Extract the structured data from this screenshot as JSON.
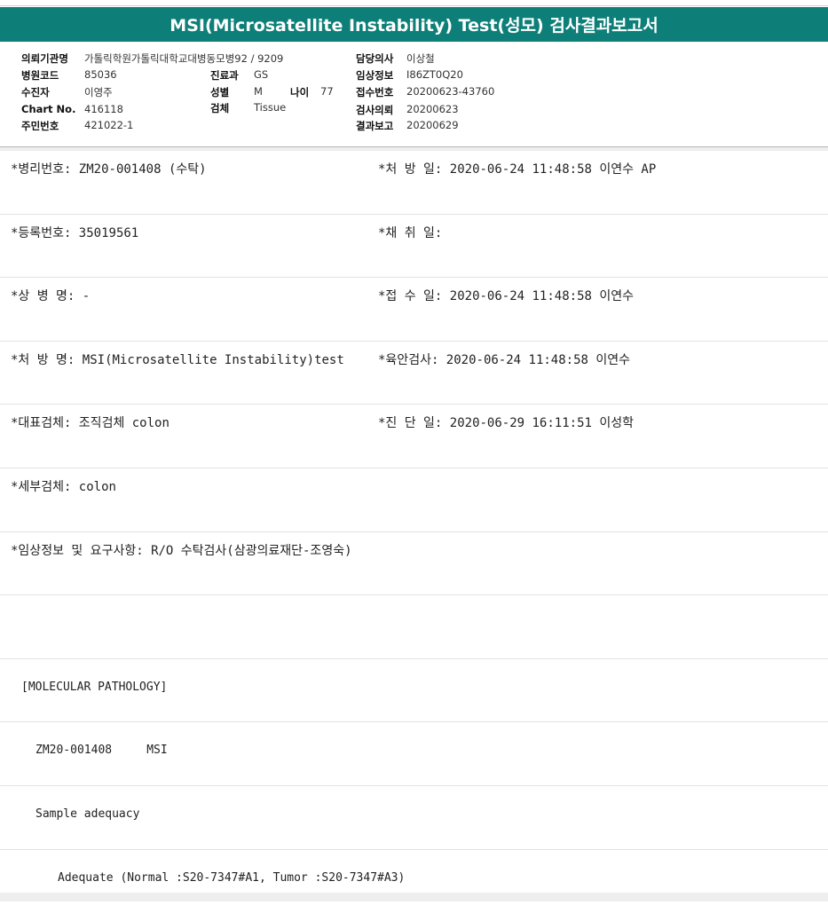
{
  "title": "MSI(Microsatellite Instability) Test(성모) 검사결과보고서",
  "info": {
    "institution": {
      "label": "의뢰기관명",
      "value": "가톨릭학원가톨릭대학교대병동모병92 / 9209"
    },
    "hospital_code": {
      "label": "병원코드",
      "value": "85036"
    },
    "patient": {
      "label": "수진자",
      "value": "이영주"
    },
    "chart_no": {
      "label": "Chart No.",
      "value": "416118"
    },
    "resident_no": {
      "label": "주민번호",
      "value": "421022-1"
    },
    "department": {
      "label": "진료과",
      "value": "GS"
    },
    "sex": {
      "label": "성별",
      "value": "M"
    },
    "age": {
      "label": "나이",
      "value": "77"
    },
    "specimen": {
      "label": "검체",
      "value": "Tissue"
    },
    "doctor": {
      "label": "담당의사",
      "value": "이상철"
    },
    "clinical_info": {
      "label": "임상정보",
      "value": "I86ZT0Q20"
    },
    "receipt_no": {
      "label": "접수번호",
      "value": "20200623-43760"
    },
    "test_request": {
      "label": "검사의뢰",
      "value": "20200623"
    },
    "result_report": {
      "label": "결과보고",
      "value": "20200629"
    }
  },
  "rows": [
    {
      "left": "*병리번호: ZM20-001408 (수탁)",
      "right": "*처 방 일: 2020-06-24 11:48:58  이연수 AP"
    },
    {
      "left": "*등록번호: 35019561",
      "right": "*채 취 일:"
    },
    {
      "left": "*상 병 명: -",
      "right": "*접 수 일: 2020-06-24 11:48:58  이연수"
    },
    {
      "left": "*처 방 명: MSI(Microsatellite Instability)test",
      "right": "*육안검사: 2020-06-24 11:48:58  이연수"
    },
    {
      "left": "*대표검체: 조직검체 colon",
      "right": "*진 단 일: 2020-06-29 16:11:51  이성학"
    },
    {
      "left": "*세부검체: colon",
      "right": ""
    },
    {
      "left": "*임상정보 및 요구사항: R/O 수탁검사(삼광의료재단-조영숙)",
      "right": ""
    }
  ],
  "report": {
    "section": "[MOLECULAR PATHOLOGY]",
    "case_line": "ZM20-001408     MSI",
    "adequacy_title": "Sample adequacy",
    "adequacy_value": "Adequate (Normal :S20-7347#A1, Tumor :S20-7347#A3)"
  }
}
